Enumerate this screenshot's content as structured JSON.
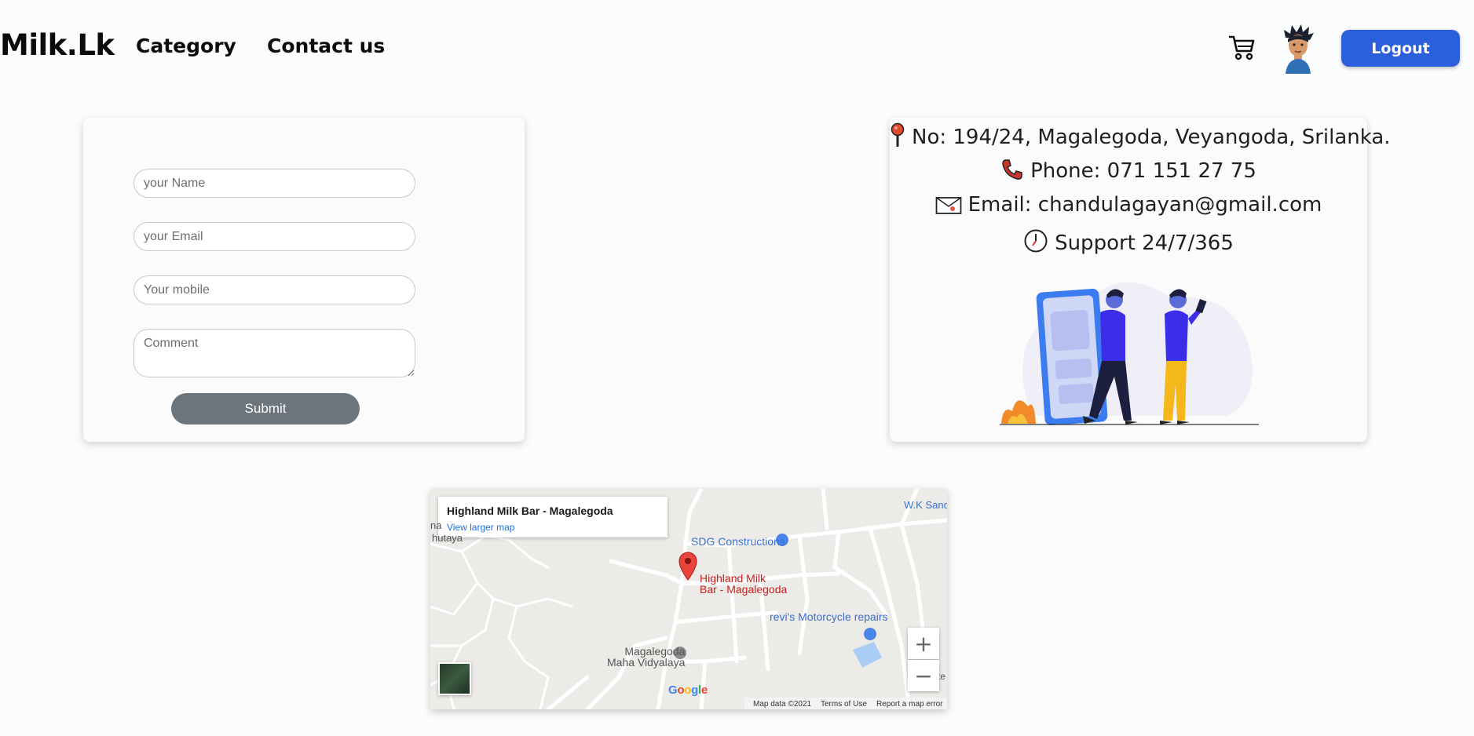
{
  "header": {
    "brand": "Milk.Lk",
    "nav": [
      "Category",
      "Contact us"
    ],
    "cart_icon": "cart-icon",
    "avatar_icon": "avatar",
    "logout_label": "Logout",
    "accent": "#2b5fdc"
  },
  "form": {
    "name_placeholder": "your Name",
    "email_placeholder": "your Email",
    "mobile_placeholder": "Your mobile",
    "comment_placeholder": "Comment",
    "submit_label": "Submit",
    "submit_color": "#6c747c"
  },
  "contact_info": {
    "address": "No: 194/24, Magalegoda, Veyangoda, Srilanka.",
    "phone": "Phone: 071 151 27 75",
    "email": "Email: chandulagayan@gmail.com",
    "support": "Support 24/7/365",
    "icons": [
      "pin-icon",
      "phone-icon",
      "envelope-icon",
      "clock-icon"
    ]
  },
  "map": {
    "place_title": "Highland Milk Bar - Magalegoda",
    "view_larger": "View larger map",
    "marker_label_line1": "Highland Milk",
    "marker_label_line2": "Bar - Magalegoda",
    "labels": {
      "sdg": "SDG Constructions",
      "revi": "revi's Motorcycle repairs",
      "school_line1": "Magalegoda",
      "school_line2": "Maha Vidyalaya",
      "wk": "W.K Sand",
      "left_top": "na",
      "left_sub": "hutaya"
    },
    "zoom_in": "+",
    "zoom_out": "−",
    "google": "Google",
    "map_data": "Map data ©2021",
    "terms": "Terms of Use",
    "report": "Report a map error",
    "right_edge": "te"
  }
}
